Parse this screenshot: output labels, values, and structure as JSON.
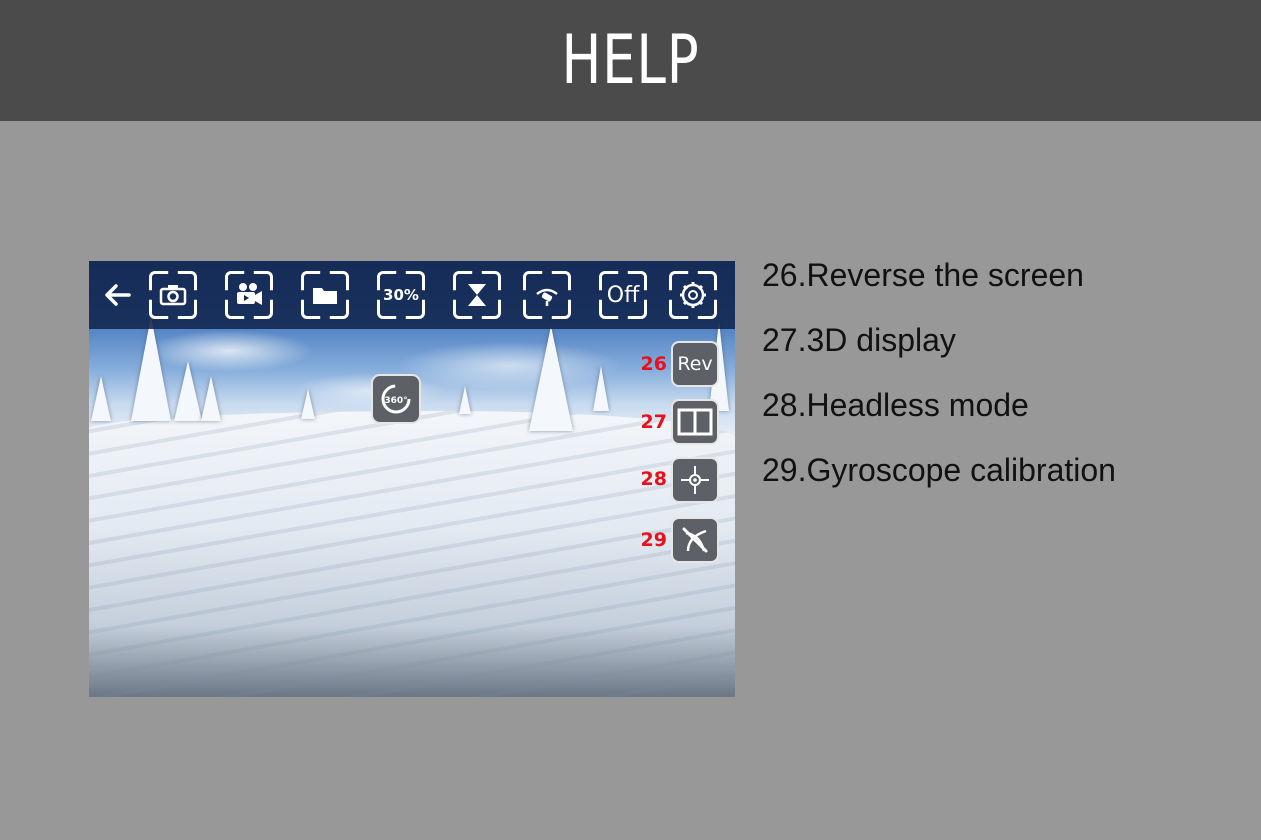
{
  "header": {
    "title": "HELP"
  },
  "toolbar": {
    "buttons": [
      {
        "icon": "arrow-left-icon"
      },
      {
        "icon": "camera-icon"
      },
      {
        "icon": "video-camera-icon"
      },
      {
        "icon": "folder-icon"
      },
      {
        "icon": "speed-percent-icon",
        "label": "30%"
      },
      {
        "icon": "hourglass-icon"
      },
      {
        "icon": "drone-flip-icon"
      },
      {
        "icon": "light-toggle-icon",
        "label": "Off"
      },
      {
        "icon": "gear-icon"
      }
    ]
  },
  "overlay": {
    "rotate_360_label": "360°"
  },
  "side_buttons": [
    {
      "number": "26",
      "label": "Rev",
      "icon": "reverse-screen-icon"
    },
    {
      "number": "27",
      "label": "",
      "icon": "split-screen-3d-icon"
    },
    {
      "number": "28",
      "label": "",
      "icon": "headless-mode-icon"
    },
    {
      "number": "29",
      "label": "",
      "icon": "gyroscope-calibration-icon"
    }
  ],
  "help_items": [
    "26.Reverse the screen",
    "27.3D display",
    "28.Headless mode",
    "29.Gyroscope calibration"
  ],
  "colors": {
    "header_bg": "#4b4b4b",
    "page_bg": "#989898",
    "toolbar_bg": "#12264e",
    "number_red": "#e8101a"
  }
}
